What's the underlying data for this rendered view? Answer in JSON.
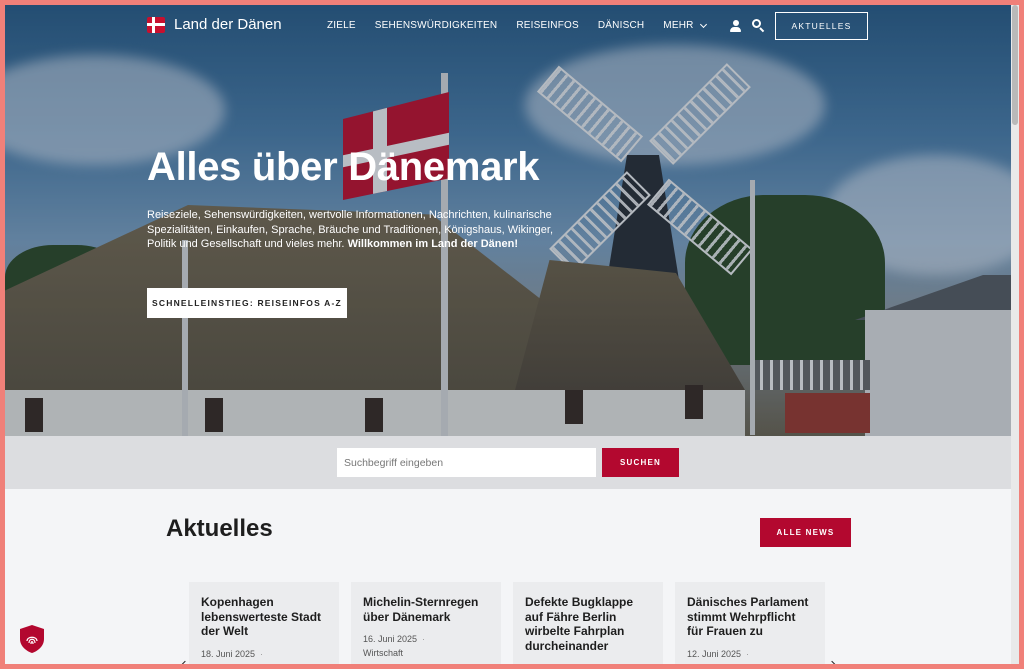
{
  "nav": {
    "brand": "Land der Dänen",
    "items": [
      {
        "label": "ZIELE"
      },
      {
        "label": "SEHENSWÜRDIGKEITEN"
      },
      {
        "label": "REISEINFOS"
      },
      {
        "label": "DÄNISCH"
      },
      {
        "label": "MEHR"
      }
    ],
    "cta": "AKTUELLES"
  },
  "hero": {
    "title": "Alles über Dänemark",
    "text": "Reiseziele, Sehenswürdigkeiten, wertvolle Informationen, Nachrichten, kulinarische Spezialitäten, Einkaufen, Sprache, Bräuche und Traditionen, Königshaus, Wikinger, Politik und Gesellschaft und vieles mehr.",
    "text_bold": "Willkommen im Land der Dänen!",
    "button": "SCHNELLEINSTIEG: REISEINFOS A-Z"
  },
  "search": {
    "placeholder": "Suchbegriff eingeben",
    "value": "",
    "button": "SUCHEN"
  },
  "news": {
    "title": "Aktuelles",
    "all_button": "ALLE NEWS",
    "cards": [
      {
        "title": "Kopenhagen lebenswerteste Stadt der Welt",
        "date": "18. Juni 2025",
        "category": ""
      },
      {
        "title": "Michelin-Sternregen über Dänemark",
        "date": "16. Juni 2025",
        "category": "Wirtschaft"
      },
      {
        "title": "Defekte Bugklappe auf Fähre Berlin wirbelte Fahrplan durcheinander",
        "date": "",
        "category": ""
      },
      {
        "title": "Dänisches Parlament stimmt Wehrpflicht für Frauen zu",
        "date": "12. Juni 2025",
        "category": ""
      }
    ]
  },
  "colors": {
    "accent": "#b3082f",
    "frame": "#f08079"
  }
}
